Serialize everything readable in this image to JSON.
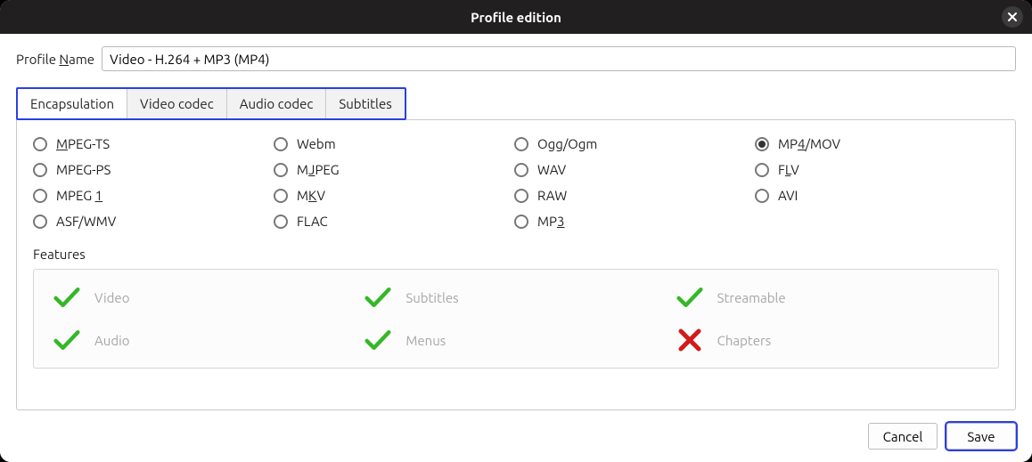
{
  "window": {
    "title": "Profile edition"
  },
  "profile": {
    "label_prefix": "Profile ",
    "label_mnemonic": "N",
    "label_suffix": "ame",
    "value": "Video - H.264 + MP3 (MP4)"
  },
  "tabs": [
    {
      "label": "Encapsulation",
      "active": true
    },
    {
      "label": "Video codec",
      "active": false
    },
    {
      "label": "Audio codec",
      "active": false
    },
    {
      "label": "Subtitles",
      "active": false
    }
  ],
  "encapsulation": {
    "selected": "MP4/MOV",
    "options": [
      {
        "pre": "",
        "u": "M",
        "post": "PEG-TS"
      },
      {
        "pre": "Webm",
        "u": "",
        "post": ""
      },
      {
        "pre": "Ogg/Ogm",
        "u": "",
        "post": ""
      },
      {
        "pre": "MP",
        "u": "4",
        "post": "/MOV"
      },
      {
        "pre": "MPEG-PS",
        "u": "",
        "post": ""
      },
      {
        "pre": "M",
        "u": "J",
        "post": "PEG"
      },
      {
        "pre": "WAV",
        "u": "",
        "post": ""
      },
      {
        "pre": "F",
        "u": "L",
        "post": "V"
      },
      {
        "pre": "MPEG ",
        "u": "1",
        "post": ""
      },
      {
        "pre": "M",
        "u": "K",
        "post": "V"
      },
      {
        "pre": "RAW",
        "u": "",
        "post": ""
      },
      {
        "pre": "AVI",
        "u": "",
        "post": ""
      },
      {
        "pre": "ASF/WMV",
        "u": "",
        "post": ""
      },
      {
        "pre": "FLAC",
        "u": "",
        "post": ""
      },
      {
        "pre": "MP",
        "u": "3",
        "post": ""
      }
    ]
  },
  "features": {
    "label": "Features",
    "items": [
      {
        "label": "Video",
        "ok": true
      },
      {
        "label": "Subtitles",
        "ok": true
      },
      {
        "label": "Streamable",
        "ok": true
      },
      {
        "label": "Audio",
        "ok": true
      },
      {
        "label": "Menus",
        "ok": true
      },
      {
        "label": "Chapters",
        "ok": false
      }
    ]
  },
  "buttons": {
    "cancel": "Cancel",
    "save": "Save"
  },
  "colors": {
    "highlight": "#2a3fe6",
    "check": "#35b727",
    "cross": "#d21b1b"
  }
}
